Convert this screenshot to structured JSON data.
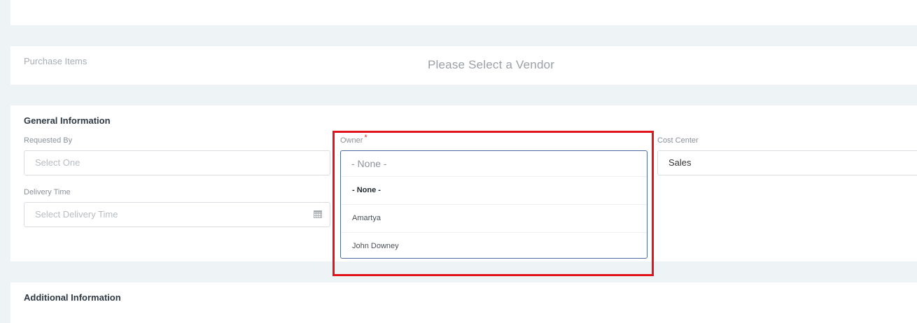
{
  "purchase_items": {
    "title": "Purchase Items",
    "message": "Please Select a Vendor"
  },
  "general": {
    "title": "General Information",
    "requested_by": {
      "label": "Requested By",
      "placeholder": "Select One"
    },
    "owner": {
      "label": "Owner",
      "required_mark": "*",
      "selected": "- None -",
      "options": [
        "- None -",
        "Amartya",
        "John Downey"
      ]
    },
    "cost_center": {
      "label": "Cost Center",
      "value": "Sales"
    },
    "delivery_time": {
      "label": "Delivery Time",
      "placeholder": "Select Delivery Time",
      "icon": "calendar-icon"
    }
  },
  "additional": {
    "title": "Additional Information"
  },
  "colors": {
    "highlight": "#e2141b",
    "dropdown_border": "#4a6aa0",
    "required": "#e0322f"
  }
}
